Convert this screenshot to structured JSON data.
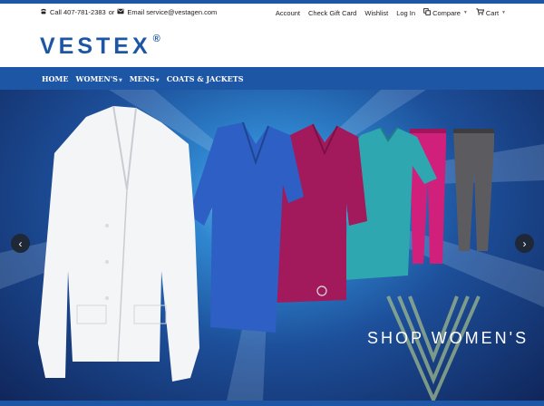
{
  "topbar": {
    "phone": "Call 407-781-2383",
    "or": "or",
    "email": "Email service@vestagen.com",
    "links": [
      "Account",
      "Check Gift Card",
      "Wishlist",
      "Log In"
    ],
    "compare": "Compare",
    "cart": "Cart"
  },
  "logo": {
    "text": "VESTEX",
    "reg": "®"
  },
  "nav": {
    "items": [
      "HOME",
      "WOMEN'S",
      "MENS",
      "COATS & JACKETS"
    ]
  },
  "hero": {
    "caption": "SHOP WOMEN'S",
    "prev_icon": "chevron-left-icon",
    "next_icon": "chevron-right-icon"
  },
  "colors": {
    "brand": "#1d56a5",
    "arrow_bg": "#1e2836"
  }
}
